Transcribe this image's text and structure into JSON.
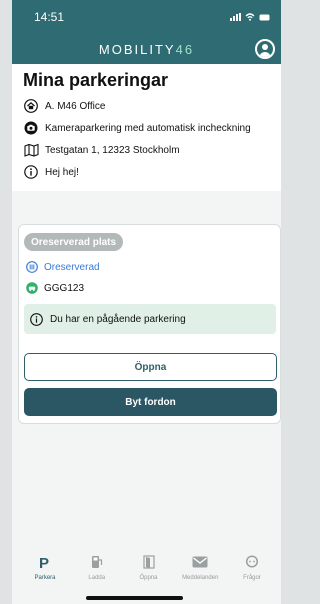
{
  "status_bar": {
    "time": "14:51"
  },
  "app_bar": {
    "brand_text": "MOBILITY",
    "brand_number": "46"
  },
  "page": {
    "title": "Mina parkeringar",
    "facility": "A. M46 Office",
    "camera_text": "Kameraparkering med automatisk incheckning",
    "address": "Testgatan 1, 12323 Stockholm",
    "message": "Hej hej!"
  },
  "parking_card": {
    "badge": "Oreserverad plats",
    "reservation_status": "Oreserverad",
    "license_plate": "GGG123",
    "alert_text": "Du har en pågående parkering",
    "open_label": "Öppna",
    "change_vehicle_label": "Byt fordon"
  },
  "tabs": [
    {
      "label": "Parkera",
      "icon": "p-icon",
      "active": true
    },
    {
      "label": "Ladda",
      "icon": "charger-icon",
      "active": false
    },
    {
      "label": "Öppna",
      "icon": "door-icon",
      "active": false
    },
    {
      "label": "Meddelanden",
      "icon": "envelope-icon",
      "active": false
    },
    {
      "label": "Frågor",
      "icon": "chat-icon",
      "active": false
    }
  ],
  "colors": {
    "header": "#2f6b72",
    "accent": "#2b5764",
    "brand_number": "#9fe0c8",
    "alert_bg": "#e1f0e7",
    "link_blue": "#3a7bd5",
    "plate_green": "#2fb36a"
  }
}
